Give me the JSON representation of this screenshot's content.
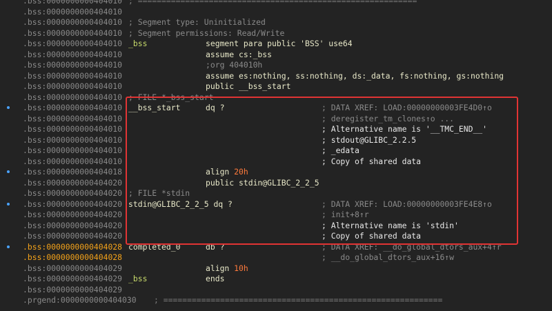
{
  "lines": [
    {
      "dot": false,
      "addr": ".bss:0000000000404010",
      "addr_hl": false,
      "full": "; ===========================================================",
      "cls": "sep"
    },
    {
      "dot": false,
      "addr": ".bss:0000000000404010",
      "addr_hl": false
    },
    {
      "dot": false,
      "addr": ".bss:0000000000404010",
      "addr_hl": false,
      "full": "; Segment type: Uninitialized"
    },
    {
      "dot": false,
      "addr": ".bss:0000000000404010",
      "addr_hl": false,
      "full": "; Segment permissions: Read/Write"
    },
    {
      "dot": false,
      "addr": ".bss:0000000000404010",
      "addr_hl": false,
      "label": "_bss",
      "instr": "segment para public 'BSS' use64"
    },
    {
      "dot": false,
      "addr": ".bss:0000000000404010",
      "addr_hl": false,
      "instr": "assume cs:_bss"
    },
    {
      "dot": false,
      "addr": ".bss:0000000000404010",
      "addr_hl": false,
      "instr": ";org 404010h",
      "instr_cmt": true
    },
    {
      "dot": false,
      "addr": ".bss:0000000000404010",
      "addr_hl": false,
      "instr": "assume es:nothing, ss:nothing, ds:_data, fs:nothing, gs:nothing"
    },
    {
      "dot": false,
      "addr": ".bss:0000000000404010",
      "addr_hl": false,
      "instr": "public __bss_start"
    },
    {
      "dot": false,
      "addr": ".bss:0000000000404010",
      "addr_hl": false,
      "full": "; FILE *_bss_start"
    },
    {
      "dot": true,
      "addr": ".bss:0000000000404010",
      "addr_hl": false,
      "label": "__bss_start",
      "instr": "dq ?",
      "comment": "; DATA XREF: LOAD:00000000003FE4D0↑o"
    },
    {
      "dot": false,
      "addr": ".bss:0000000000404010",
      "addr_hl": false,
      "comment": "; deregister_tm_clones↑o ..."
    },
    {
      "dot": false,
      "addr": ".bss:0000000000404010",
      "addr_hl": false,
      "comment": "; Alternative name is '__TMC_END__'",
      "comment_bright": true
    },
    {
      "dot": false,
      "addr": ".bss:0000000000404010",
      "addr_hl": false,
      "comment": "; stdout@GLIBC_2.2.5",
      "comment_bright": true
    },
    {
      "dot": false,
      "addr": ".bss:0000000000404010",
      "addr_hl": false,
      "comment": "; _edata",
      "comment_bright": true
    },
    {
      "dot": false,
      "addr": ".bss:0000000000404010",
      "addr_hl": false,
      "comment": "; Copy of shared data",
      "comment_bright": true
    },
    {
      "dot": true,
      "addr": ".bss:0000000000404018",
      "addr_hl": false,
      "instr_parts": [
        "align ",
        "20h"
      ]
    },
    {
      "dot": false,
      "addr": ".bss:0000000000404020",
      "addr_hl": false,
      "instr": "public stdin@GLIBC_2_2_5"
    },
    {
      "dot": false,
      "addr": ".bss:0000000000404020",
      "addr_hl": false,
      "full": "; FILE *stdin"
    },
    {
      "dot": true,
      "addr": ".bss:0000000000404020",
      "addr_hl": false,
      "label": "stdin@GLIBC_2_2_5",
      "label_inline_instr": " dq ?",
      "comment": "; DATA XREF: LOAD:00000000003FE4E8↑o"
    },
    {
      "dot": false,
      "addr": ".bss:0000000000404020",
      "addr_hl": false,
      "comment": "; init+8↑r"
    },
    {
      "dot": false,
      "addr": ".bss:0000000000404020",
      "addr_hl": false,
      "comment": "; Alternative name is 'stdin'",
      "comment_bright": true
    },
    {
      "dot": false,
      "addr": ".bss:0000000000404020",
      "addr_hl": false,
      "comment": "; Copy of shared data",
      "comment_bright": true
    },
    {
      "dot": true,
      "addr": ".bss:0000000000404028",
      "addr_hl": true,
      "label": "completed_0",
      "instr": "db ?",
      "comment": "; DATA XREF: __do_global_dtors_aux+4↑r"
    },
    {
      "dot": false,
      "addr": ".bss:0000000000404028",
      "addr_hl": true,
      "comment": "; __do_global_dtors_aux+16↑w"
    },
    {
      "dot": false,
      "addr": ".bss:0000000000404029",
      "addr_hl": false,
      "instr_parts": [
        "align ",
        "10h"
      ]
    },
    {
      "dot": false,
      "addr": ".bss:0000000000404029",
      "addr_hl": false,
      "label": "_bss",
      "instr": "ends"
    },
    {
      "dot": false,
      "addr": ".bss:0000000000404029",
      "addr_hl": false
    },
    {
      "dot": false,
      "addr": ".prgend:0000000000404030",
      "addr_hl": false,
      "full": "; ===========================================================",
      "cls": "sep",
      "addr_green": true
    }
  ],
  "colors": {
    "background": "#232323",
    "address": "#8a8a8a",
    "address_highlight": "#f5a31a",
    "number": "#ff7a3c",
    "highlight_box": "#e23434",
    "breakpoint_dot": "#4aa3ff"
  }
}
